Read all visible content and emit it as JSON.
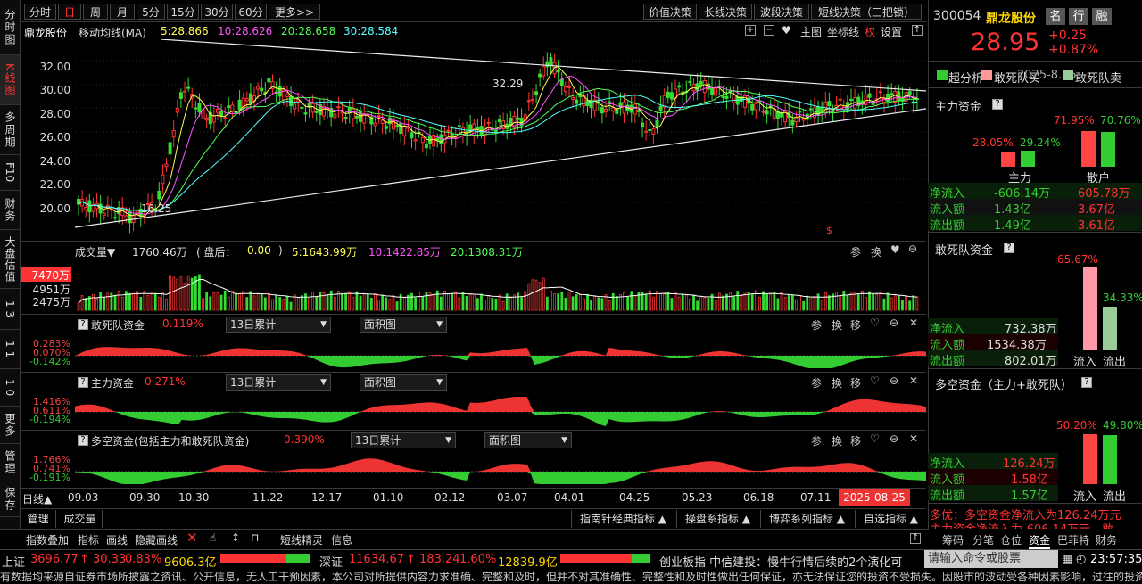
{
  "side": [
    "分时图",
    "K线图",
    "多周期",
    "F10",
    "财务",
    "大盘估值",
    "1 3",
    "1 1",
    "1 0",
    "更多",
    "管理",
    "保存"
  ],
  "periods": [
    "分时",
    "日",
    "周",
    "月",
    "5分",
    "15分",
    "30分",
    "60分",
    "更多>>"
  ],
  "decisions": [
    "价值决策",
    "长线决策",
    "波段决策",
    "短线决策（三把锁）"
  ],
  "stock": {
    "name": "鼎龙股份",
    "code": "300054",
    "price": "28.95",
    "chg": "+0.25",
    "pct": "+0.87%",
    "btn1": "名",
    "btn2": "行",
    "btn3": "融"
  },
  "ma": {
    "label": "移动均线(MA)",
    "ma5": "5:28.866",
    "ma10": "10:28.626",
    "ma20": "20:28.658",
    "ma30": "30:28.584"
  },
  "toolbar": {
    "main": "主图",
    "coord": "坐标线",
    "quan": "权",
    "settings": "设置"
  },
  "price_axis": [
    "32.00",
    "30.00",
    "28.00",
    "26.00",
    "24.00",
    "22.00",
    "20.00"
  ],
  "annot": {
    "high": "32.29",
    "low": "16.25"
  },
  "vol": {
    "title": "成交量▼",
    "val": "1760.46万",
    "after_label": "盘后：",
    "after_val": "0.00",
    "v5": "5:1643.99万",
    "v10": "10:1422.85万",
    "v20": "20:1308.31万",
    "axis1": "7470万",
    "axis2": "4951万",
    "axis3": "2475万",
    "icons": [
      "参",
      "换"
    ]
  },
  "panels": [
    {
      "title": "敢死队资金",
      "pct": "0.119%",
      "period": "13日累计",
      "style": "面积图",
      "axis": [
        "0.283%",
        "0.070%",
        "-0.142%"
      ]
    },
    {
      "title": "主力资金",
      "pct": "0.271%",
      "period": "13日累计",
      "style": "面积图",
      "axis": [
        "1.416%",
        "0.611%",
        "-0.194%"
      ]
    },
    {
      "title": "多空资金(包括主力和敢死队资金)",
      "pct": "0.390%",
      "period": "13日累计",
      "style": "面积图",
      "axis": [
        "1.766%",
        "0.741%",
        "-0.191%"
      ]
    }
  ],
  "panel_icons": [
    "参",
    "换",
    "移"
  ],
  "xaxis": {
    "label": "日线▲",
    "ticks": [
      "09.03",
      "09.30",
      "10.30",
      "11.22",
      "12.17",
      "01.10",
      "02.12",
      "03.07",
      "04.01",
      "04.25",
      "05.23",
      "06.18",
      "07.11"
    ],
    "cur": "2025-08-25"
  },
  "bottom_tabs": [
    "管理",
    "成交量"
  ],
  "ind_tabs": [
    "指南针经典指标 ▲",
    "操盘系指标 ▲",
    "博弈系列指标 ▲",
    "自选指标 ▲"
  ],
  "bottom_tools": [
    "指数叠加",
    "指标",
    "画线",
    "隐藏画线"
  ],
  "bottom_tools2": [
    "短线精灵",
    "信息"
  ],
  "right": {
    "legend": [
      "超分析",
      "敢死队买",
      "敢死队卖"
    ],
    "legend_vals": "2025-8.15",
    "main_fund": "主力资金",
    "mf_top": [
      "71.95%",
      "70.76%"
    ],
    "mf_mid": [
      "28.05%",
      "29.24%"
    ],
    "mf_labels": [
      "主力",
      "散户"
    ],
    "mf_rows": [
      [
        "净流入",
        "-606.14万",
        "605.78万"
      ],
      [
        "流入额",
        "1.43亿",
        "3.67亿"
      ],
      [
        "流出额",
        "1.49亿",
        "3.61亿"
      ]
    ],
    "gsd": "敢死队资金",
    "gsd_pcts": [
      "65.67%",
      "34.33%"
    ],
    "gsd_rows": [
      [
        "净流入",
        "732.38万"
      ],
      [
        "流入额",
        "1534.38万"
      ],
      [
        "流出额",
        "802.01万"
      ]
    ],
    "gsd_labels": [
      "流入",
      "流出"
    ],
    "dk": "多空资金（主力+敢死队）",
    "dk_pcts": [
      "50.20%",
      "49.80%"
    ],
    "dk_rows": [
      [
        "净流入",
        "126.24万"
      ],
      [
        "流入额",
        "1.58亿"
      ],
      [
        "流出额",
        "1.57亿"
      ]
    ],
    "dk_labels": [
      "流入",
      "流出"
    ],
    "msg": "多优：多空资金净流入为126.24万元",
    "msg2": "主力资金净流入为-606.14万元，敢",
    "tabs": [
      "筹码",
      "分笔",
      "仓位",
      "资金",
      "巴菲特",
      "财务"
    ]
  },
  "status": {
    "sh": "上证",
    "sh_val": "3696.77",
    "sh_chg": "↑ 30.33",
    "sh_pct": "0.83%",
    "sh_amt": "9606.3亿",
    "sz": "深证",
    "sz_val": "11634.67",
    "sz_chg": "↑ 183.24",
    "sz_pct": "1.60%",
    "sz_amt": "12839.9亿",
    "news": "创业板指 中信建投：慢牛行情后续的2个演化可",
    "cmd": "请输入命令或股票",
    "time": "23:57:35",
    "disclaimer": "有数据均来源自证券市场所披露之资讯、公开信息，无人工干预因素，本公司对所提供内容力求准确、完整和及时，但并不对其准确性、完整性和及时性做出任何保证，亦无法保证您的投资不受损失。因股市的波动受各种因素影响，过往的投资"
  }
}
